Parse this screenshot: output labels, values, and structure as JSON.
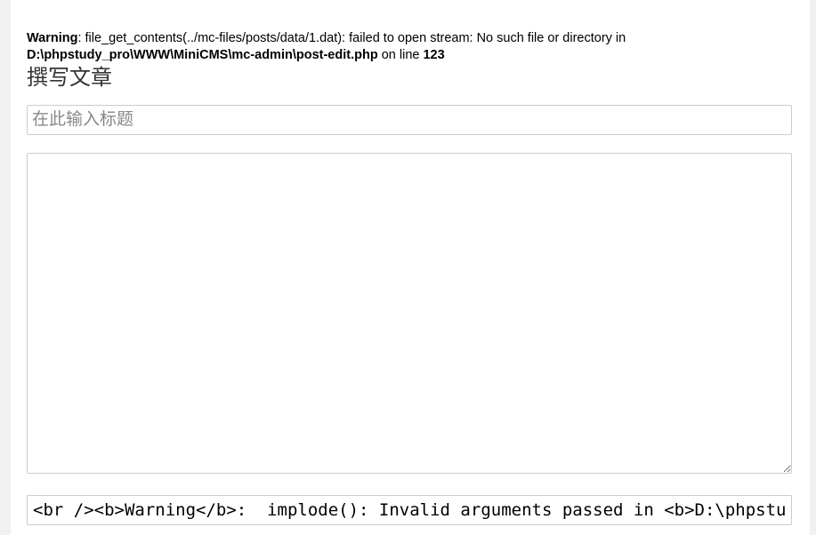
{
  "php_warning": {
    "label": "Warning",
    "message": ": file_get_contents(../mc-files/posts/data/1.dat): failed to open stream: No such file or directory in ",
    "file": "D:\\phpstudy_pro\\WWW\\MiniCMS\\mc-admin\\post-edit.php",
    "on_line_text": " on line ",
    "line": "123"
  },
  "editor": {
    "heading": "撰写文章",
    "title_placeholder": "在此输入标题",
    "title_value": "",
    "content_value": "",
    "tags_value": "<br /><b>Warning</b>:  implode(): Invalid arguments passed in <b>D:\\phpstudy_pro\\WWW\\MiniCMS\\mc-admin\\post-edit.php</b> on line <b>"
  }
}
